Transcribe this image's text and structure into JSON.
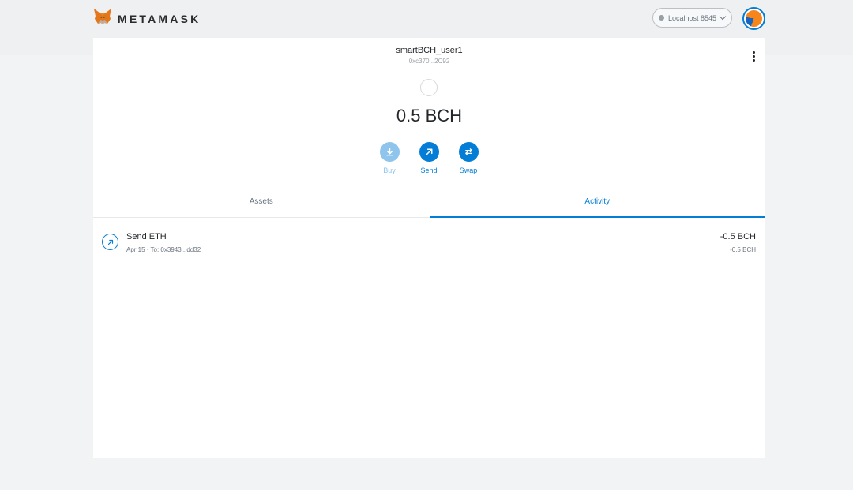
{
  "header": {
    "brand": "METAMASK",
    "network_label": "Localhost 8545"
  },
  "account": {
    "name": "smartBCH_user1",
    "address": "0xc370...2C92"
  },
  "balance": {
    "display": "0.5 BCH"
  },
  "actions": {
    "buy_label": "Buy",
    "send_label": "Send",
    "swap_label": "Swap"
  },
  "tabs": {
    "assets_label": "Assets",
    "activity_label": "Activity",
    "active": "Activity"
  },
  "transactions": [
    {
      "title": "Send ETH",
      "subtitle": "Apr 15 · To: 0x3943...dd32",
      "amount": "-0.5 BCH",
      "secondary_amount": "-0.5 BCH",
      "icon": "arrow-up-right-icon"
    }
  ],
  "colors": {
    "accent": "#037dd6",
    "fox_orange": "#e2761b",
    "background": "#f2f3f4"
  }
}
